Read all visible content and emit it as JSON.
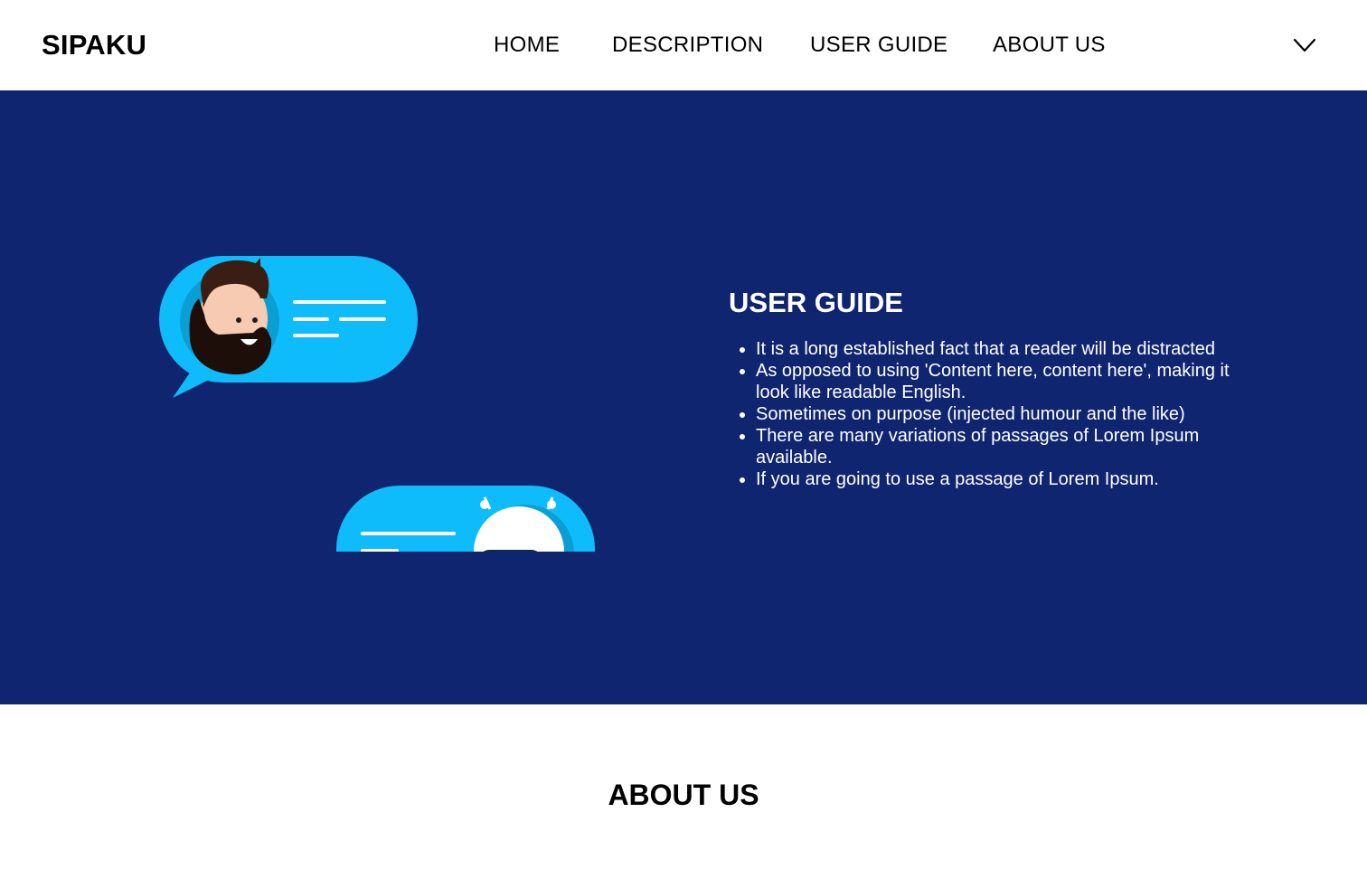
{
  "header": {
    "brand": "SIPAKU",
    "nav": {
      "home": "HOME",
      "description": "DESCRIPTION",
      "user_guide": "USER GUIDE",
      "about_us": "ABOUT US"
    },
    "menu_icon": "chevron-down-icon"
  },
  "hero": {
    "background_color": "#10256f",
    "title": "USER GUIDE",
    "items": [
      "It is a long established fact that a reader will be distracted",
      "As opposed to using 'Content here, content here', making it look like readable English.",
      "Sometimes on purpose (injected humour and the like)",
      "There are many variations of passages of Lorem Ipsum available.",
      "If you are going to use a passage of Lorem Ipsum."
    ],
    "illustration": {
      "bubble_color": "#0ebcfb",
      "icons": [
        "man-avatar-icon",
        "robot-avatar-icon"
      ]
    }
  },
  "about": {
    "title": "ABOUT US"
  }
}
